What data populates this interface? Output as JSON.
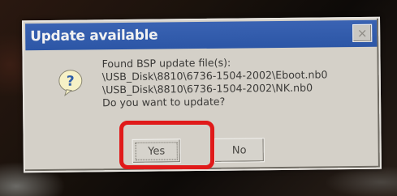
{
  "dialog": {
    "title": "Update available",
    "close_glyph": "×",
    "icon": "question-icon",
    "message_lines": [
      "Found BSP update file(s):",
      "\\USB_Disk\\8810\\6736-1504-2002\\Eboot.nb0",
      "\\USB_Disk\\8810\\6736-1504-2002\\NK.nb0",
      "Do you want to update?"
    ],
    "buttons": {
      "yes": "Yes",
      "no": "No"
    }
  },
  "colors": {
    "titlebar": "#2c56a6",
    "dialog_bg": "#d4d0c8",
    "highlight": "#e01a1a"
  }
}
